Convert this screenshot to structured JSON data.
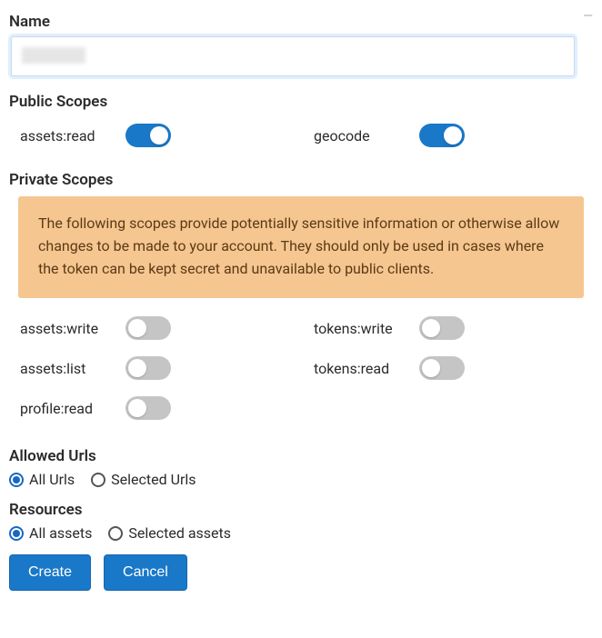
{
  "name_section": {
    "label": "Name",
    "value": ""
  },
  "public_scopes": {
    "label": "Public Scopes",
    "items": [
      {
        "key": "assets_read",
        "label": "assets:read",
        "enabled": true
      },
      {
        "key": "geocode",
        "label": "geocode",
        "enabled": true
      }
    ]
  },
  "private_scopes": {
    "label": "Private Scopes",
    "warning": "The following scopes provide potentially sensitive information or otherwise allow changes to be made to your account. They should only be used in cases where the token can be kept secret and unavailable to public clients.",
    "items": [
      {
        "key": "assets_write",
        "label": "assets:write",
        "enabled": false
      },
      {
        "key": "tokens_write",
        "label": "tokens:write",
        "enabled": false
      },
      {
        "key": "assets_list",
        "label": "assets:list",
        "enabled": false
      },
      {
        "key": "tokens_read",
        "label": "tokens:read",
        "enabled": false
      },
      {
        "key": "profile_read",
        "label": "profile:read",
        "enabled": false
      }
    ]
  },
  "allowed_urls": {
    "label": "Allowed Urls",
    "options": [
      {
        "key": "all",
        "label": "All Urls",
        "selected": true
      },
      {
        "key": "selected",
        "label": "Selected Urls",
        "selected": false
      }
    ]
  },
  "resources": {
    "label": "Resources",
    "options": [
      {
        "key": "all",
        "label": "All assets",
        "selected": true
      },
      {
        "key": "selected",
        "label": "Selected assets",
        "selected": false
      }
    ]
  },
  "buttons": {
    "create": "Create",
    "cancel": "Cancel"
  }
}
